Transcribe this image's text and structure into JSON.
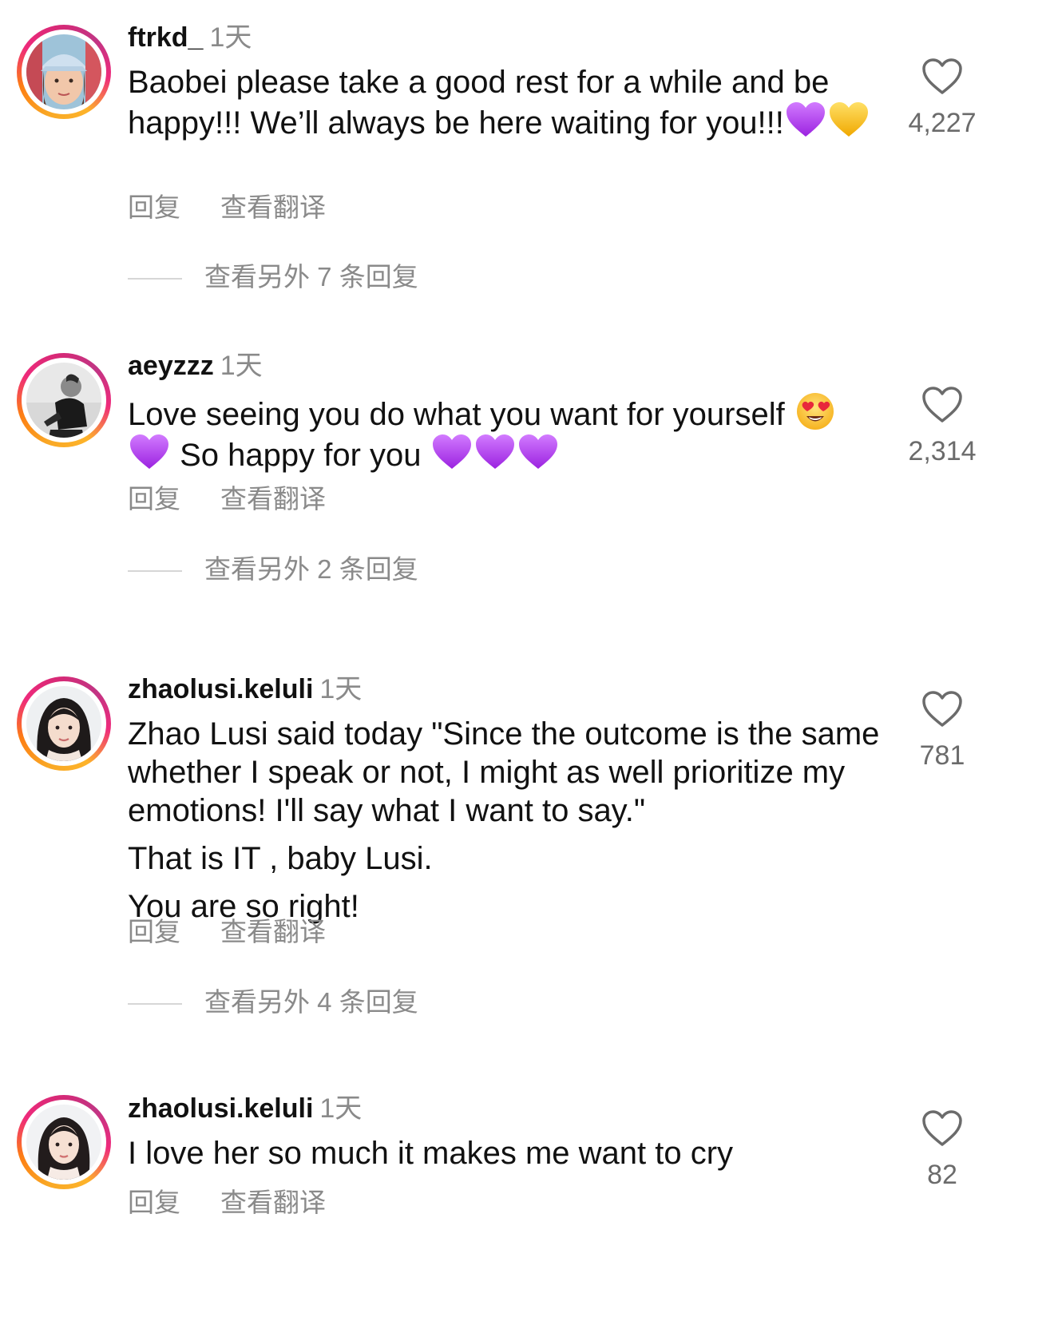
{
  "comments": [
    {
      "username": "ftrkd_",
      "time": "1天",
      "text_before_emoji": "Baobei please take a good rest for a while and be happy!!! We’ll always be here waiting for you!!!",
      "emojis": [
        "purple-heart",
        "yellow-heart"
      ],
      "reply_label": "回复",
      "translate_label": "查看翻译",
      "more_replies": "查看另外 7 条回复",
      "likes": "4,227"
    },
    {
      "username": "aeyzzz",
      "time": "1天",
      "text_part1": "Love seeing you do what you want for yourself",
      "text_part2": "So happy for you",
      "emojis": [
        "heart-eyes-face",
        "purple-heart",
        "purple-heart",
        "purple-heart",
        "purple-heart"
      ],
      "reply_label": "回复",
      "translate_label": "查看翻译",
      "more_replies": "查看另外 2 条回复",
      "likes": "2,314"
    },
    {
      "username": "zhaolusi.keluli",
      "time": "1天",
      "text_line1": "Zhao Lusi said today \"Since the outcome is the same whether I speak or not, I might as well prioritize my emotions! I'll say what I want to say.\"",
      "text_line2": "That is IT , baby Lusi.",
      "text_line3": "You are so right!",
      "reply_label": "回复",
      "translate_label": "查看翻译",
      "more_replies": "查看另外 4 条回复",
      "likes": "781"
    },
    {
      "username": "zhaolusi.keluli",
      "time": "1天",
      "text": "I love her so much it makes me want to cry",
      "reply_label": "回复",
      "translate_label": "查看翻译",
      "likes": "82"
    }
  ],
  "colors": {
    "text_primary": "#111111",
    "text_secondary": "#8a8a8a",
    "like_count": "#6b6b6b",
    "story_ring": [
      "#f9a825",
      "#ee2a7b",
      "#c13584"
    ],
    "purple_heart": "#b43cf0",
    "yellow_heart": "#f7c21a"
  },
  "icons": {
    "like": "heart-outline-icon"
  }
}
